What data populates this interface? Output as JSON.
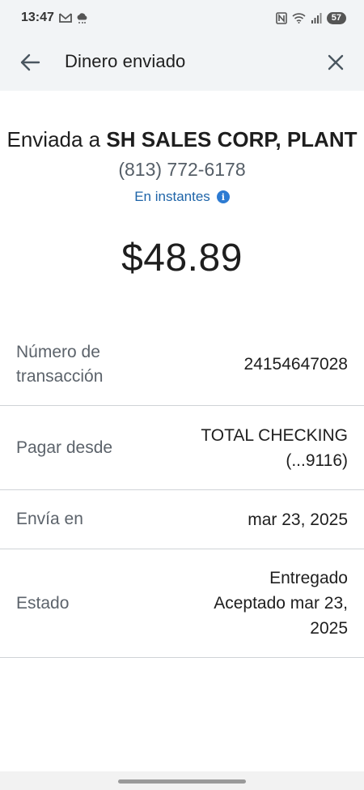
{
  "status_bar": {
    "time": "13:47",
    "battery": "57"
  },
  "app_bar": {
    "title": "Dinero enviado"
  },
  "summary": {
    "sent_prefix": "Enviada a",
    "recipient": "SH SALES CORP, PLANT",
    "phone": "(813) 772-6178",
    "speed": "En instantes",
    "amount": "$48.89"
  },
  "details": {
    "transaction_label_line1": "Número de",
    "transaction_label_line2": "transacción",
    "transaction_value": "24154647028",
    "pay_from_label": "Pagar desde",
    "pay_from_line1": "TOTAL CHECKING",
    "pay_from_line2": "(...9116)",
    "sent_on_label": "Envía en",
    "sent_on_value": "mar 23, 2025",
    "status_label": "Estado",
    "status_line1": "Entregado",
    "status_line2": "Aceptado mar 23,",
    "status_line3": "2025"
  },
  "colors": {
    "link_blue": "#1e64a8",
    "info_blue": "#2d7bd2",
    "header_bg": "#f2f4f6"
  },
  "icons": {
    "back": "arrow-left",
    "close": "x",
    "info": "info-circle"
  }
}
